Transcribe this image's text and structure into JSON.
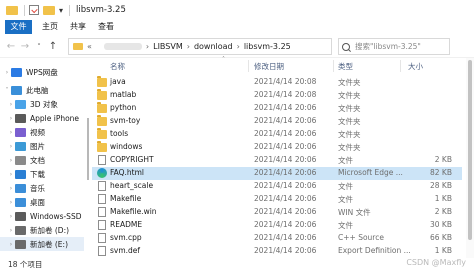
{
  "window": {
    "title": "libsvm-3.25"
  },
  "ribbon": {
    "tabs": [
      "文件",
      "主页",
      "共享",
      "查看"
    ]
  },
  "address": {
    "path": [
      "LIBSVM",
      "download",
      "libsvm-3.25"
    ],
    "search_placeholder": "搜索\"libsvm-3.25\""
  },
  "sidebar": {
    "items": [
      {
        "label": "WPS网盘",
        "icon": "cloud-icon",
        "color": "#2b7be4"
      },
      {
        "label": "此电脑",
        "icon": "computer-icon",
        "color": "#3a8fd9"
      },
      {
        "label": "3D 对象",
        "icon": "3d-objects-icon",
        "color": "#4aa3e8"
      },
      {
        "label": "Apple iPhone",
        "icon": "phone-icon",
        "color": "#5a5a5a"
      },
      {
        "label": "视频",
        "icon": "video-icon",
        "color": "#7a5fd0"
      },
      {
        "label": "图片",
        "icon": "picture-icon",
        "color": "#3c9ad6"
      },
      {
        "label": "文档",
        "icon": "document-icon",
        "color": "#8a8a8a"
      },
      {
        "label": "下载",
        "icon": "download-icon",
        "color": "#2a7fd4"
      },
      {
        "label": "音乐",
        "icon": "music-icon",
        "color": "#3b8ed8"
      },
      {
        "label": "桌面",
        "icon": "desktop-icon",
        "color": "#3c8fd9"
      },
      {
        "label": "Windows-SSD",
        "icon": "drive-icon",
        "color": "#5b5b5b"
      },
      {
        "label": "新加卷 (D:)",
        "icon": "drive-icon",
        "color": "#6a6a6a"
      },
      {
        "label": "新加卷 (E:)",
        "icon": "drive-icon",
        "color": "#6a6a6a"
      }
    ]
  },
  "columns": {
    "name": "名称",
    "date": "修改日期",
    "type": "类型",
    "size": "大小"
  },
  "files": [
    {
      "name": "java",
      "date": "2021/4/14 20:08",
      "type": "文件夹",
      "size": "",
      "kind": "folder"
    },
    {
      "name": "matlab",
      "date": "2021/4/14 20:08",
      "type": "文件夹",
      "size": "",
      "kind": "folder"
    },
    {
      "name": "python",
      "date": "2021/4/14 20:06",
      "type": "文件夹",
      "size": "",
      "kind": "folder"
    },
    {
      "name": "svm-toy",
      "date": "2021/4/14 20:06",
      "type": "文件夹",
      "size": "",
      "kind": "folder"
    },
    {
      "name": "tools",
      "date": "2021/4/14 20:06",
      "type": "文件夹",
      "size": "",
      "kind": "folder"
    },
    {
      "name": "windows",
      "date": "2021/4/14 20:06",
      "type": "文件夹",
      "size": "",
      "kind": "folder"
    },
    {
      "name": "COPYRIGHT",
      "date": "2021/4/14 20:06",
      "type": "文件",
      "size": "2 KB",
      "kind": "file"
    },
    {
      "name": "FAQ.html",
      "date": "2021/4/14 20:06",
      "type": "Microsoft Edge ...",
      "size": "82 KB",
      "kind": "edge"
    },
    {
      "name": "heart_scale",
      "date": "2021/4/14 20:06",
      "type": "文件",
      "size": "28 KB",
      "kind": "file"
    },
    {
      "name": "Makefile",
      "date": "2021/4/14 20:06",
      "type": "文件",
      "size": "1 KB",
      "kind": "file"
    },
    {
      "name": "Makefile.win",
      "date": "2021/4/14 20:06",
      "type": "WIN 文件",
      "size": "2 KB",
      "kind": "file"
    },
    {
      "name": "README",
      "date": "2021/4/14 20:06",
      "type": "文件",
      "size": "30 KB",
      "kind": "file"
    },
    {
      "name": "svm.cpp",
      "date": "2021/4/14 20:06",
      "type": "C++ Source",
      "size": "66 KB",
      "kind": "file"
    },
    {
      "name": "svm.def",
      "date": "2021/4/14 20:06",
      "type": "Export Definition ...",
      "size": "1 KB",
      "kind": "file"
    }
  ],
  "selected_index": 7,
  "status": {
    "count": "18 个项目"
  },
  "watermark": "CSDN @Maxfly"
}
